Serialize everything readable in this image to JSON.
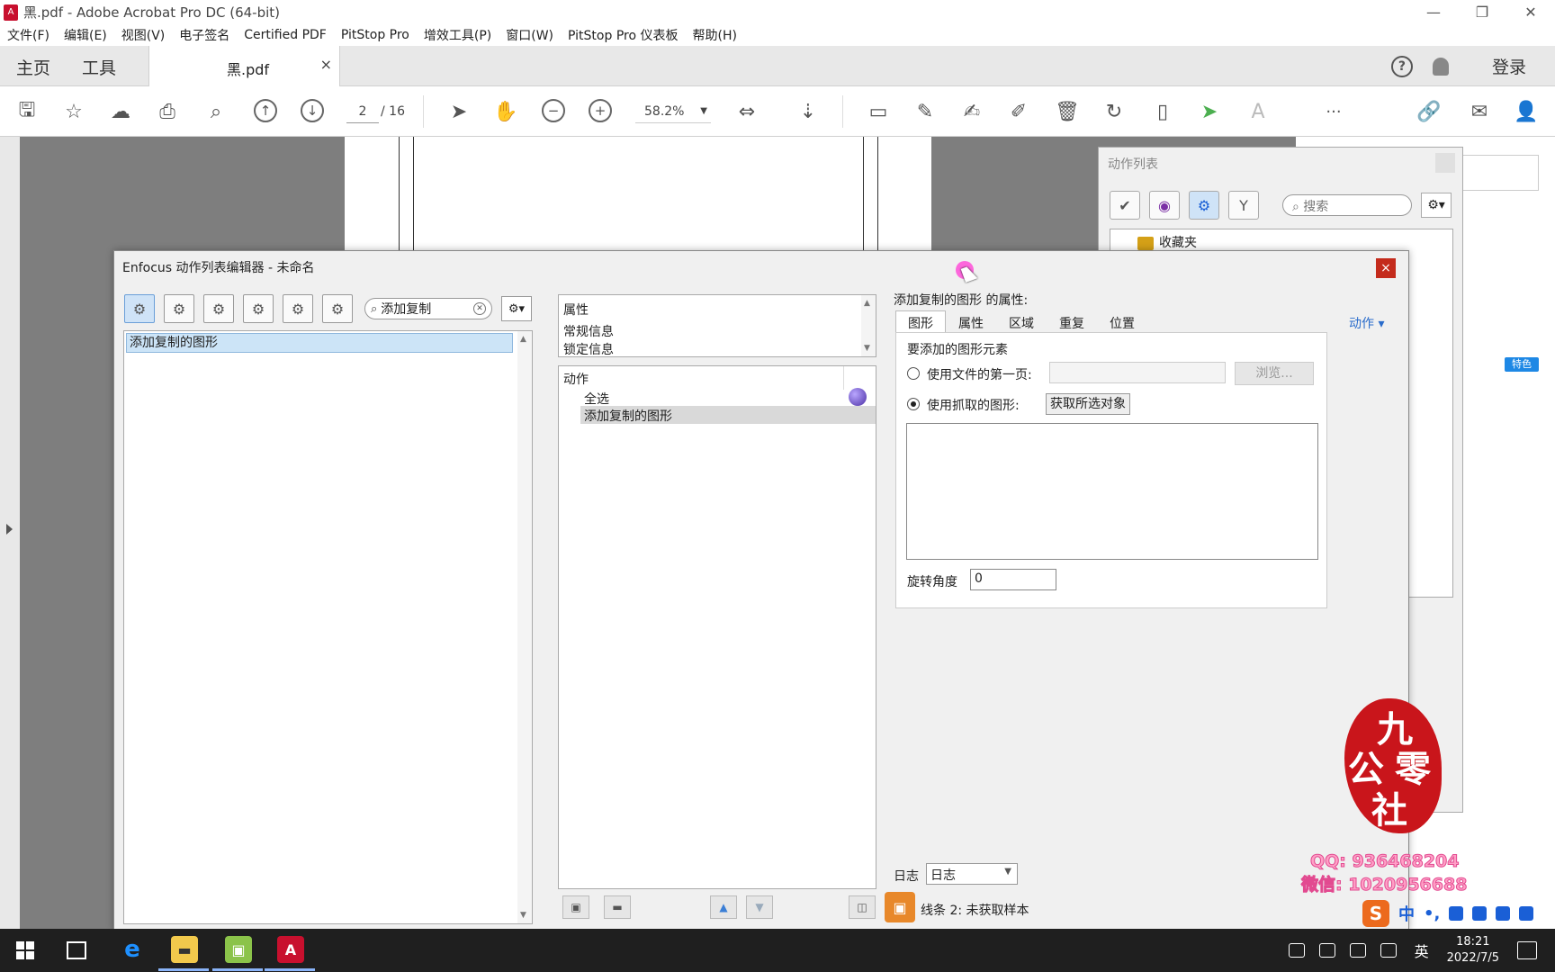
{
  "window": {
    "title": "黑.pdf - Adobe Acrobat Pro DC (64-bit)",
    "controls": [
      "—",
      "❐",
      "✕"
    ]
  },
  "menu": [
    "文件(F)",
    "编辑(E)",
    "视图(V)",
    "电子签名",
    "Certified PDF",
    "PitStop Pro",
    "增效工具(P)",
    "窗口(W)",
    "PitStop Pro 仪表板",
    "帮助(H)"
  ],
  "tabs": {
    "home": "主页",
    "tools": "工具",
    "document": "黑.pdf",
    "close": "×",
    "help": "?",
    "login": "登录"
  },
  "toolbar": {
    "page_current": "2",
    "page_total": "/ 16",
    "zoom": "58.2%",
    "more": "···"
  },
  "right_panel": {
    "badge": "特色"
  },
  "action_list": {
    "title": "动作列表",
    "search_placeholder": "搜索",
    "favorites": "收藏夹"
  },
  "editor": {
    "title": "Enfocus 动作列表编辑器 - 未命名",
    "search_value": "添加复制",
    "left_list": [
      "添加复制的图形"
    ],
    "properties": {
      "header": "属性",
      "items": [
        "常规信息",
        "锁定信息"
      ]
    },
    "actions": {
      "header": "动作",
      "items": [
        "全选",
        "添加复制的图形"
      ]
    },
    "props_title": "添加复制的图形 的属性:",
    "tabs": [
      "图形",
      "属性",
      "区域",
      "重复",
      "位置"
    ],
    "action_menu": "动作 ▾",
    "section": "要添加的图形元素",
    "radio_first_page": "使用文件的第一页:",
    "browse": "浏览...",
    "radio_captured": "使用抓取的图形:",
    "grab_button": "获取所选对象",
    "rotation_label": "旋转角度",
    "rotation_value": "0",
    "log_label": "日志",
    "log_value": "日志",
    "status": "线条 2: 未获取样本"
  },
  "watermark": {
    "seal_chars": [
      "九",
      "公",
      "零",
      "社"
    ],
    "qq": "QQ: 936468204",
    "wechat": "微信: 1020956688"
  },
  "ime": {
    "lang": "中",
    "extra": "•,"
  },
  "taskbar": {
    "lang": "英",
    "time": "18:21",
    "date": "2022/7/5"
  }
}
